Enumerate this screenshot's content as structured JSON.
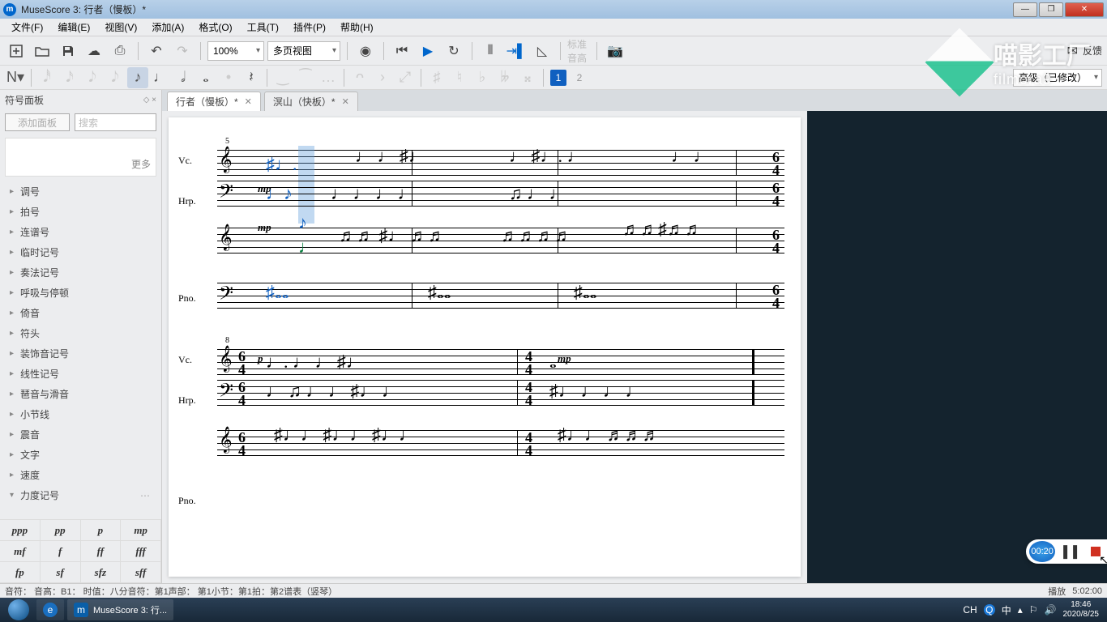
{
  "title": "MuseScore 3: 行者（慢板）*",
  "menu": [
    "文件(F)",
    "编辑(E)",
    "视图(V)",
    "添加(A)",
    "格式(O)",
    "工具(T)",
    "插件(P)",
    "帮助(H)"
  ],
  "toolbar": {
    "zoom": "100%",
    "view": "多页视图",
    "concert_pitch": "标准音高",
    "feedback": "反馈"
  },
  "notebar": {
    "voice1": "1",
    "voice2": "2",
    "workspace": "高级（已修改）"
  },
  "sidepanel": {
    "title": "符号面板",
    "add": "添加面板",
    "search_ph": "搜索",
    "more": "更多",
    "items": [
      "调号",
      "拍号",
      "连谱号",
      "临时记号",
      "奏法记号",
      "呼吸与停顿",
      "倚音",
      "符头",
      "装饰音记号",
      "线性记号",
      "琶音与滑音",
      "小节线",
      "震音",
      "文字",
      "速度",
      "力度记号"
    ],
    "dynamics": [
      "ppp",
      "pp",
      "p",
      "mp",
      "mf",
      "f",
      "ff",
      "fff",
      "fp",
      "sf",
      "sfz",
      "sff"
    ]
  },
  "tabs": [
    {
      "label": "行者（慢板）*"
    },
    {
      "label": "溟山（快板）*"
    }
  ],
  "score": {
    "instruments_sys1": [
      "Vc.",
      "Hrp.",
      "Pno."
    ],
    "instruments_sys2": [
      "Vc.",
      "Hrp.",
      "Pno."
    ],
    "measure1": "5",
    "measure2": "8",
    "dyn_mp": "mp",
    "dyn_p": "p",
    "ts1": "6\n4",
    "ts2": "4\n4"
  },
  "watermark": {
    "brand": "喵影工厂",
    "sub": "filmora9"
  },
  "recorder": {
    "time": "00:20"
  },
  "status": {
    "left": "音符：  音高：B1：  时值：八分音符：第1声部：  第1小节：第1拍：第2谱表（竖琴）",
    "mode": "播放",
    "time": "5:02:00"
  },
  "taskbar": {
    "app": "MuseScore 3: 行...",
    "ime": "CH",
    "q": "Q",
    "zh": "中",
    "clock": "18:46",
    "date": "2020/8/25"
  }
}
